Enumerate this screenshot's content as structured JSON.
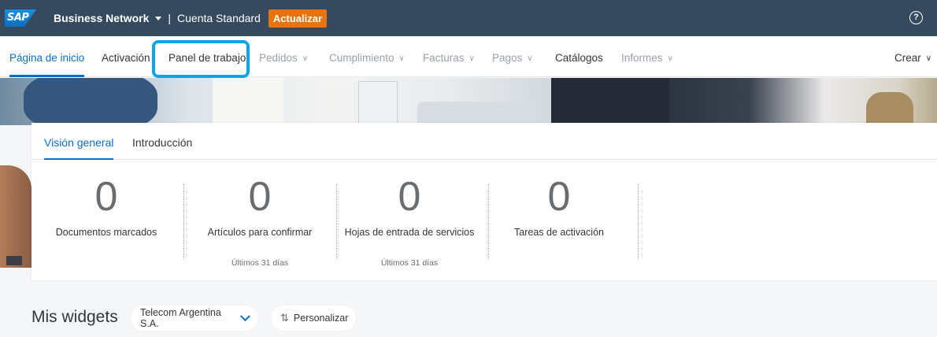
{
  "shellbar": {
    "logo_text": "SAP",
    "product": "Business Network",
    "account_label": "Cuenta Standard",
    "upgrade_label": "Actualizar",
    "help_icon": "?"
  },
  "nav": {
    "items": [
      {
        "label": "Página de inicio"
      },
      {
        "label": "Activación"
      },
      {
        "label": "Panel de trabajo"
      },
      {
        "label": "Pedidos"
      },
      {
        "label": "Cumplimiento"
      },
      {
        "label": "Facturas"
      },
      {
        "label": "Pagos"
      },
      {
        "label": "Catálogos"
      },
      {
        "label": "Informes"
      }
    ],
    "create_label": "Crear"
  },
  "hero": {
    "icon": "banner-photo"
  },
  "overview": {
    "tabs": [
      "Visión general",
      "Introducción"
    ],
    "tiles": [
      {
        "value": "0",
        "label": "Documentos marcados",
        "sub": ""
      },
      {
        "value": "0",
        "label": "Artículos para confirmar",
        "sub": "Últimos 31 días"
      },
      {
        "value": "0",
        "label": "Hojas de entrada de servicios",
        "sub": "Últimos 31 días"
      },
      {
        "value": "0",
        "label": "Tareas de activación",
        "sub": ""
      }
    ]
  },
  "widgets": {
    "title": "Mis widgets",
    "customer_select": "Telecom Argentina S.A.",
    "personalize_label": "Personalizar"
  },
  "colors": {
    "shellbar": "#354a5f",
    "accent": "#0a6ed1",
    "upgrade": "#e9730c",
    "highlight": "#0aa7e6"
  }
}
